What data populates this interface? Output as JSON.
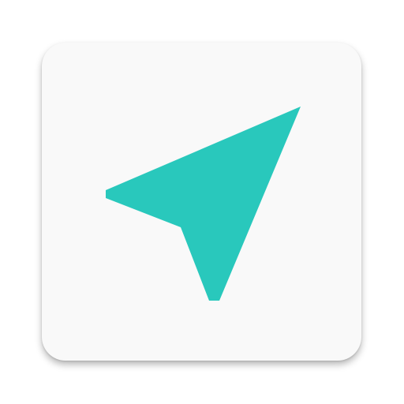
{
  "app_icon": {
    "icon_name": "navigation-arrow-icon",
    "tile_color": "#f9f9f9",
    "glyph_color": "#29c8bc"
  }
}
